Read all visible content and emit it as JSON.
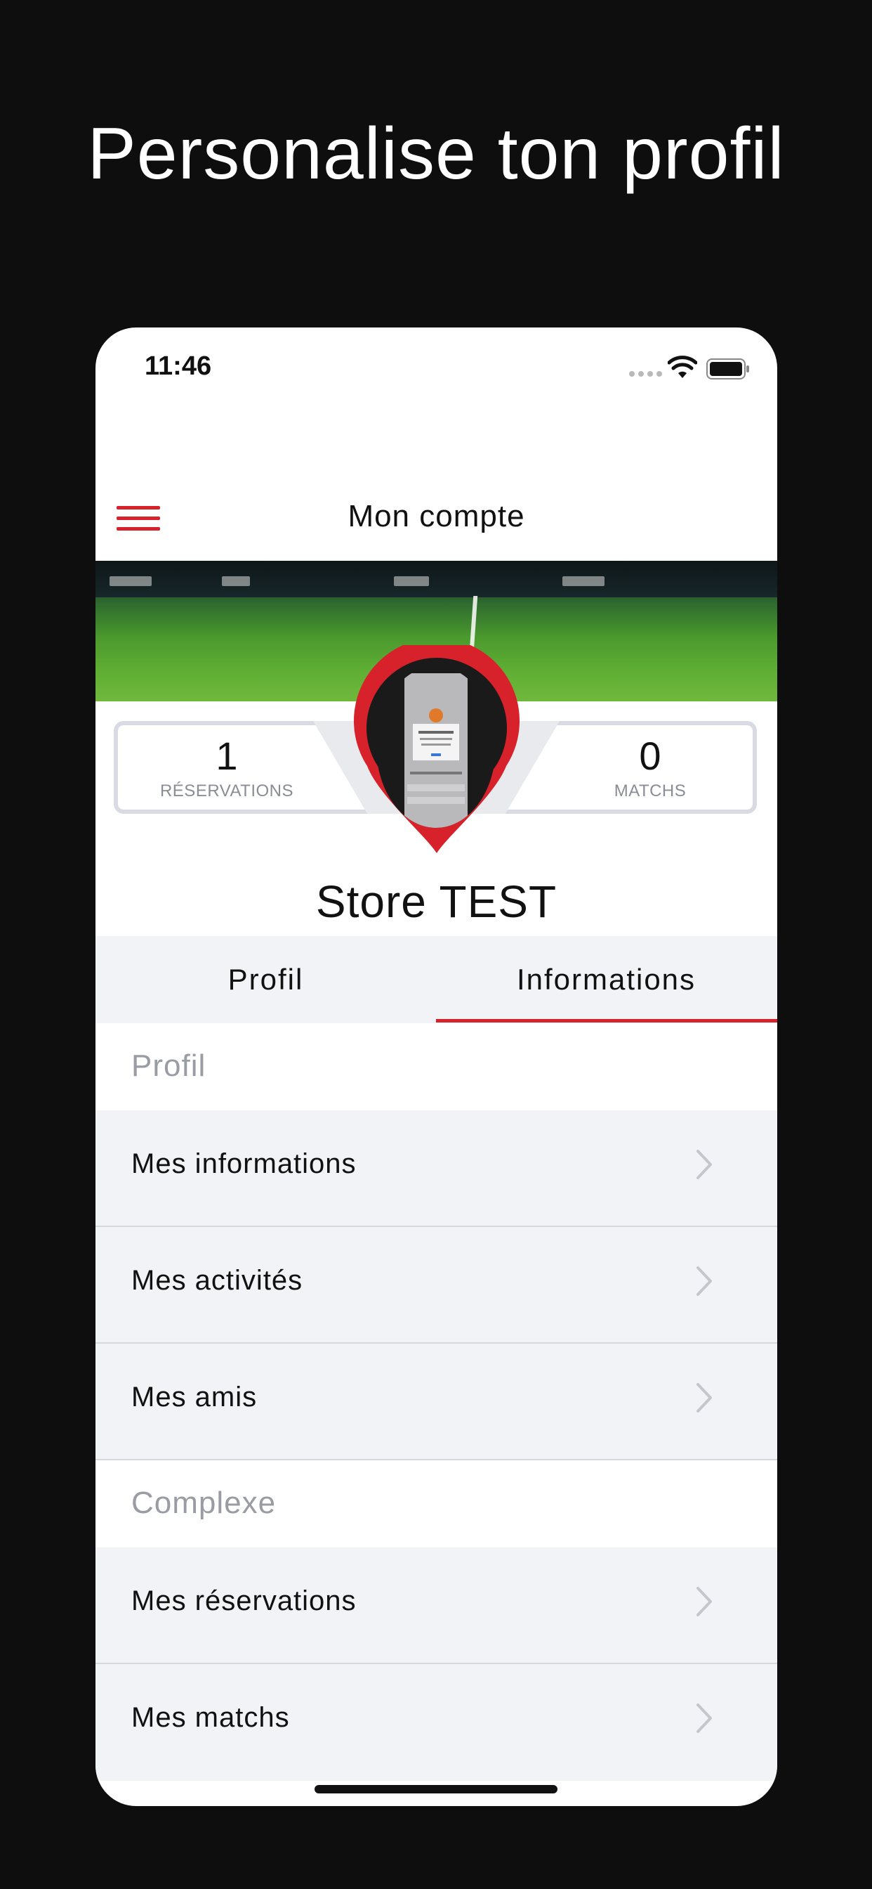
{
  "headline": "Personalise ton profil",
  "status_bar": {
    "time": "11:46"
  },
  "nav": {
    "title": "Mon compte"
  },
  "stats": [
    {
      "value": "1",
      "label": "RÉSERVATIONS"
    },
    {
      "value": "0",
      "label": "MATCHS"
    }
  ],
  "profile": {
    "name": "Store TEST"
  },
  "tabs": [
    {
      "label": "Profil",
      "active": false
    },
    {
      "label": "Informations",
      "active": true
    }
  ],
  "sections": [
    {
      "title": "Profil",
      "items": [
        "Mes informations",
        "Mes activités",
        "Mes amis"
      ]
    },
    {
      "title": "Complexe",
      "items": [
        "Mes réservations",
        "Mes matchs"
      ]
    }
  ],
  "colors": {
    "accent": "#d7222c",
    "background": "#0e0e0f",
    "row_background": "#f2f3f7"
  }
}
